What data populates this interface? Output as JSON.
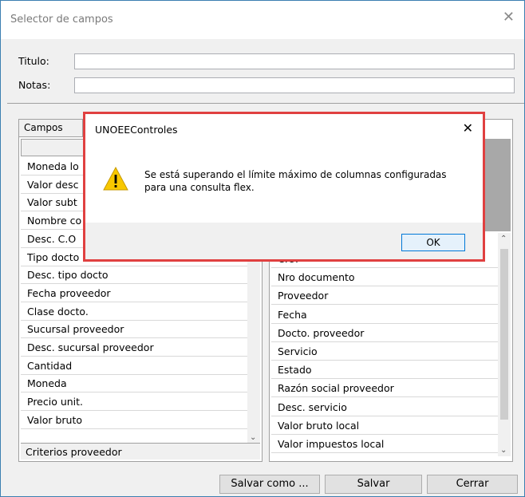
{
  "window": {
    "title": "Selector de campos",
    "close_glyph": "✕"
  },
  "form": {
    "titulo_label": "Titulo:",
    "titulo_value": "",
    "notas_label": "Notas:",
    "notas_value": ""
  },
  "left_panel": {
    "header": "Campos",
    "items": [
      "Moneda lo",
      "Valor desc",
      "Valor subt",
      "Nombre co",
      "Desc. C.O",
      "Tipo docto",
      "Desc. tipo docto",
      "Fecha proveedor",
      "Clase docto.",
      "Sucursal proveedor",
      "Desc. sucursal proveedor",
      "Cantidad",
      "Moneda",
      "Precio unit.",
      "Valor bruto"
    ],
    "footer": "Criterios proveedor"
  },
  "right_panel": {
    "items": [
      "C.O.",
      "Nro documento",
      "Proveedor",
      "Fecha",
      "Docto. proveedor",
      "Servicio",
      "Estado",
      "Razón social proveedor",
      "Desc. servicio",
      "Valor bruto local",
      "Valor impuestos local"
    ]
  },
  "buttons": {
    "save_as": "Salvar como ...",
    "save": "Salvar",
    "close": "Cerrar"
  },
  "dialog": {
    "title": "UNOEEControles",
    "close_glyph": "✕",
    "message_line1": "Se está superando el límite máximo de columnas configuradas",
    "message_line2": "para una consulta flex.",
    "ok": "OK",
    "icon": "warning-icon"
  },
  "colors": {
    "dialog_border": "#e04040",
    "window_border": "#3c7fb1",
    "ok_border": "#0078d7"
  }
}
